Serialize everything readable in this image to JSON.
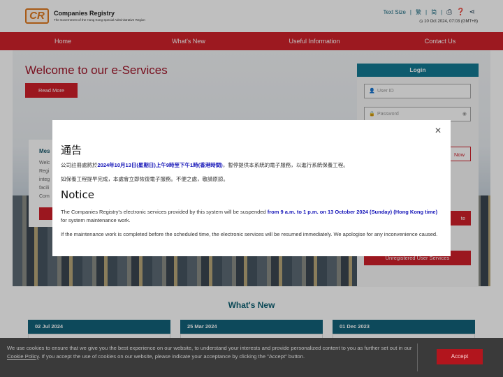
{
  "header": {
    "logo_text": "CR",
    "brand": "Companies Registry",
    "subtitle": "The Government of the Hong Kong Special Administrative Region",
    "text_size": "Text Size",
    "lang_tc": "繁",
    "lang_sc": "简",
    "datetime": "10 Oct 2024, 07:03 (GMT+8)"
  },
  "nav": [
    "Home",
    "What's New",
    "Useful Information",
    "Contact Us"
  ],
  "hero": {
    "title": "Welcome to our e-Services",
    "read_more": "Read More",
    "msg_title": "Mes",
    "msg_lines": [
      "Welc",
      "Regi",
      "integ",
      "facili",
      "Com"
    ]
  },
  "login": {
    "title": "Login",
    "user_placeholder": "User ID",
    "password_placeholder": "Password",
    "btn1": "Now",
    "btn2": "te",
    "unregistered": "Unregistered User Services"
  },
  "whats_new": {
    "title": "What's New",
    "cards": [
      "02 Jul 2024",
      "25 Mar 2024",
      "01 Dec 2023"
    ]
  },
  "modal": {
    "zh_title": "通告",
    "zh_p1_pre": "公司註冊處將於",
    "zh_p1_bold": "2024年10月13日(星期日)上午9時至下午1時(香港時間)",
    "zh_p1_post": "，暫停提供本系統的電子服務，以進行系統保養工程。",
    "zh_p2": "如保養工程提早完成，本處會立即恢復電子服務。不便之處，敬請原諒。",
    "en_title": "Notice",
    "en_p1_pre": "The Companies Registry's electronic services provided by this system will be suspended ",
    "en_p1_bold": "from 9 a.m. to 1 p.m. on 13 October 2024 (Sunday) (Hong Kong time)",
    "en_p1_post": " for system maintenance work.",
    "en_p2": "If the maintenance work is completed before the scheduled time, the electronic services will be resumed immediately. We apologise for any inconvenience caused."
  },
  "cookie": {
    "pre": "We use cookies to ensure that we give you the best experience on our website, to understand your interests and provide personalized content to you as further set out in our ",
    "link": "Cookie Policy",
    "post": ". If you accept the use of cookies on our website, please indicate your acceptance by clicking the \"Accept\" button.",
    "accept": "Accept"
  }
}
